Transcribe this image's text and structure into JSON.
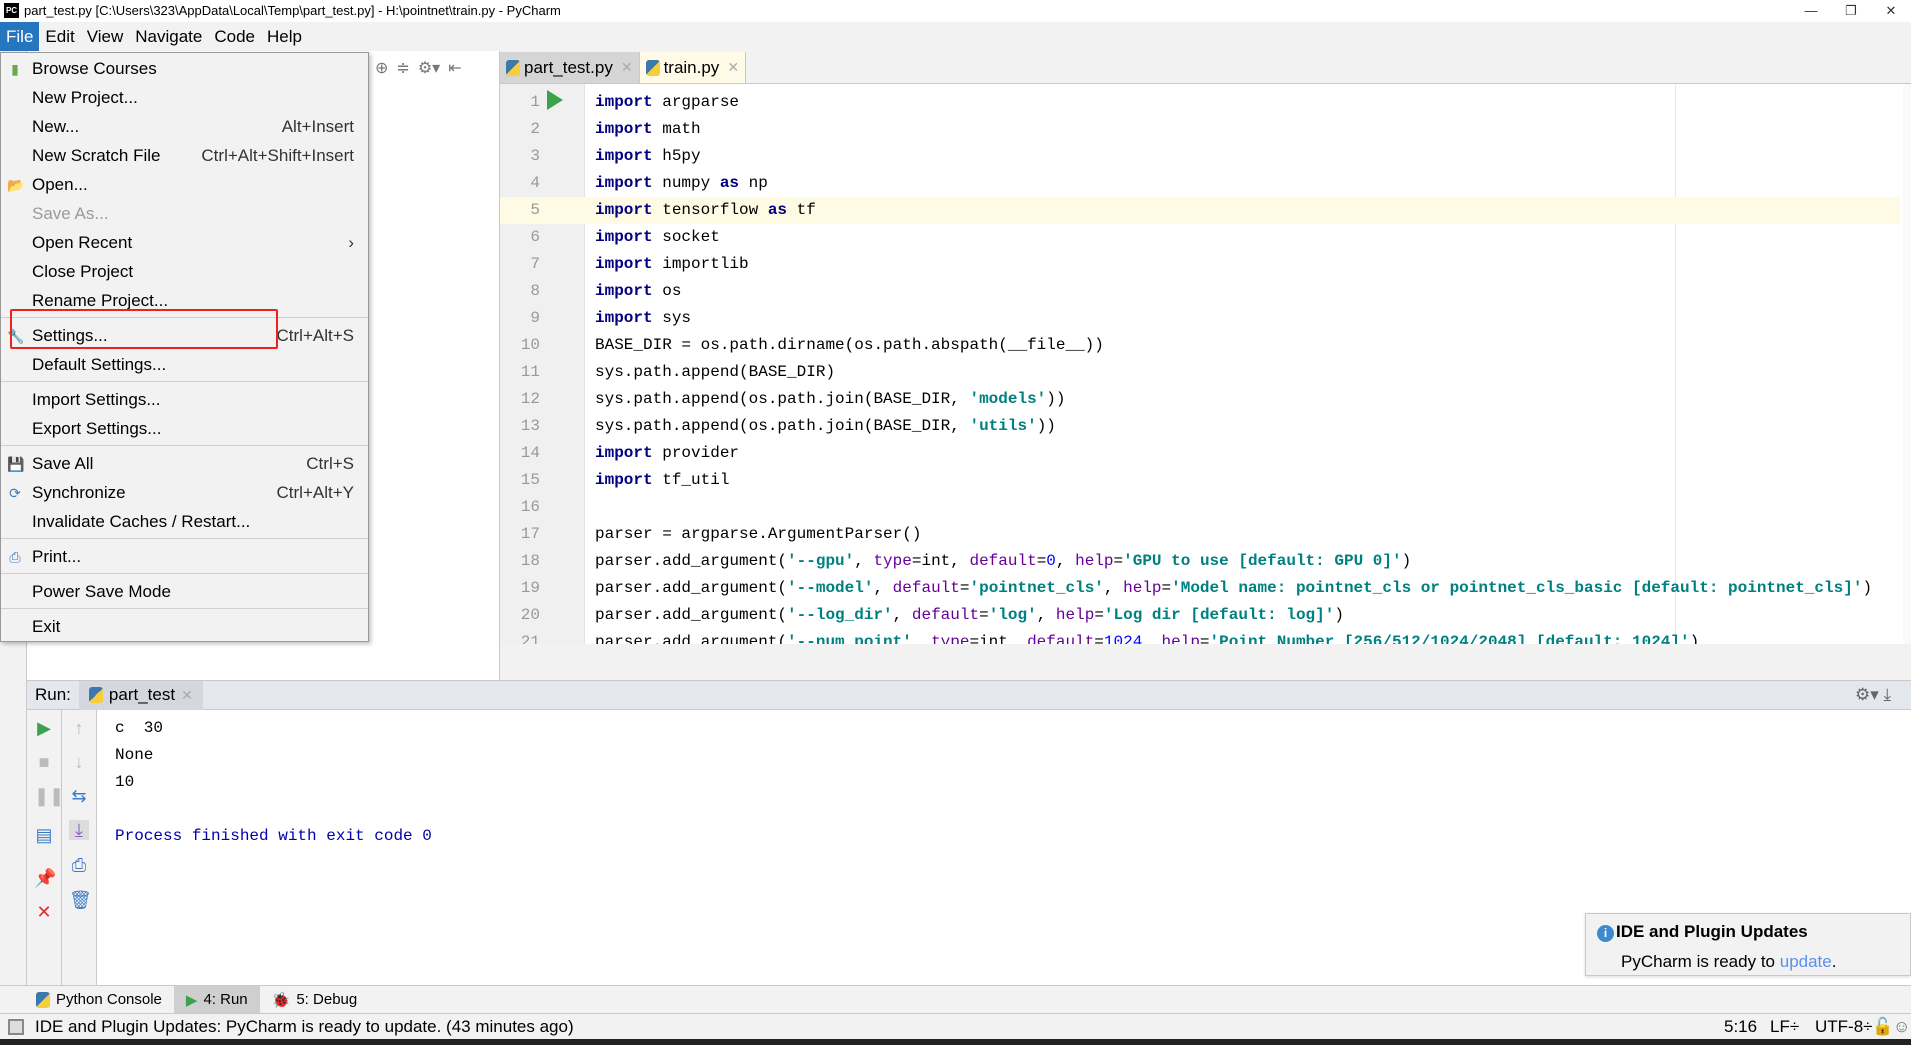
{
  "window": {
    "title": "part_test.py [C:\\Users\\323\\AppData\\Local\\Temp\\part_test.py] - H:\\pointnet\\train.py - PyCharm",
    "logo": "PC",
    "minimize": "—",
    "restore": "❐",
    "close": "✕"
  },
  "menubar": [
    "File",
    "Edit",
    "View",
    "Navigate",
    "Code",
    "Help"
  ],
  "file_menu": {
    "groups": [
      [
        {
          "label": "Browse Courses",
          "icon": "book-icon",
          "shortcut": ""
        },
        {
          "label": "New Project...",
          "shortcut": ""
        },
        {
          "label": "New...",
          "shortcut": "Alt+Insert"
        },
        {
          "label": "New Scratch File",
          "shortcut": "Ctrl+Alt+Shift+Insert"
        },
        {
          "label": "Open...",
          "icon": "folder-icon",
          "shortcut": ""
        },
        {
          "label": "Save As...",
          "shortcut": "",
          "disabled": true
        },
        {
          "label": "Open Recent",
          "shortcut": "",
          "submenu": true
        },
        {
          "label": "Close Project",
          "shortcut": ""
        },
        {
          "label": "Rename Project...",
          "shortcut": ""
        }
      ],
      [
        {
          "label": "Settings...",
          "icon": "wrench-icon",
          "shortcut": "Ctrl+Alt+S",
          "highlighted_box": true
        },
        {
          "label": "Default Settings...",
          "shortcut": ""
        }
      ],
      [
        {
          "label": "Import Settings...",
          "shortcut": ""
        },
        {
          "label": "Export Settings...",
          "shortcut": ""
        }
      ],
      [
        {
          "label": "Save All",
          "icon": "save-icon",
          "shortcut": "Ctrl+S"
        },
        {
          "label": "Synchronize",
          "icon": "sync-icon",
          "shortcut": "Ctrl+Alt+Y"
        },
        {
          "label": "Invalidate Caches / Restart...",
          "shortcut": ""
        }
      ],
      [
        {
          "label": "Print...",
          "icon": "printer-icon",
          "shortcut": ""
        }
      ],
      [
        {
          "label": "Power Save Mode",
          "shortcut": ""
        }
      ],
      [
        {
          "label": "Exit",
          "shortcut": ""
        }
      ]
    ],
    "highlight_color": "#f02020"
  },
  "editor": {
    "tabs": [
      {
        "label": "part_test.py",
        "active": false
      },
      {
        "label": "train.py",
        "active": true
      }
    ],
    "current_line": 5,
    "lines": [
      [
        [
          "import",
          "kw"
        ],
        [
          " argparse",
          ""
        ]
      ],
      [
        [
          "import",
          "kw"
        ],
        [
          " math",
          ""
        ]
      ],
      [
        [
          "import",
          "kw"
        ],
        [
          " h5py",
          ""
        ]
      ],
      [
        [
          "import",
          "kw"
        ],
        [
          " numpy ",
          ""
        ],
        [
          "as",
          "kw"
        ],
        [
          " np",
          ""
        ]
      ],
      [
        [
          "import",
          "kw"
        ],
        [
          " tensorflow ",
          ""
        ],
        [
          "as",
          "kw"
        ],
        [
          " tf",
          ""
        ]
      ],
      [
        [
          "import",
          "kw"
        ],
        [
          " socket",
          ""
        ]
      ],
      [
        [
          "import",
          "kw"
        ],
        [
          " importlib",
          ""
        ]
      ],
      [
        [
          "import",
          "kw"
        ],
        [
          " os",
          ""
        ]
      ],
      [
        [
          "import",
          "kw"
        ],
        [
          " sys",
          ""
        ]
      ],
      [
        [
          "BASE_DIR = os.path.dirname(os.path.abspath(__file__))",
          ""
        ]
      ],
      [
        [
          "sys.path.append(BASE_DIR)",
          ""
        ]
      ],
      [
        [
          "sys.path.append(os.path.join(BASE_DIR, ",
          ""
        ],
        [
          "'models'",
          "str"
        ],
        [
          "))",
          ""
        ]
      ],
      [
        [
          "sys.path.append(os.path.join(BASE_DIR, ",
          ""
        ],
        [
          "'utils'",
          "str"
        ],
        [
          "))",
          ""
        ]
      ],
      [
        [
          "import",
          "kw"
        ],
        [
          " provider",
          ""
        ]
      ],
      [
        [
          "import",
          "kw"
        ],
        [
          " tf_util",
          ""
        ]
      ],
      [],
      [
        [
          "parser = argparse.ArgumentParser()",
          ""
        ]
      ],
      [
        [
          "parser.add_argument(",
          ""
        ],
        [
          "'--gpu'",
          "str"
        ],
        [
          ", ",
          ""
        ],
        [
          "type",
          "kwarg"
        ],
        [
          "=int, ",
          ""
        ],
        [
          "default",
          "kwarg"
        ],
        [
          "=",
          ""
        ],
        [
          "0",
          "num"
        ],
        [
          ", ",
          ""
        ],
        [
          "help",
          "kwarg"
        ],
        [
          "=",
          ""
        ],
        [
          "'GPU to use [default: GPU 0]'",
          "str"
        ],
        [
          ")",
          ""
        ]
      ],
      [
        [
          "parser.add_argument(",
          ""
        ],
        [
          "'--model'",
          "str"
        ],
        [
          ", ",
          ""
        ],
        [
          "default",
          "kwarg"
        ],
        [
          "=",
          ""
        ],
        [
          "'pointnet_cls'",
          "str"
        ],
        [
          ", ",
          ""
        ],
        [
          "help",
          "kwarg"
        ],
        [
          "=",
          ""
        ],
        [
          "'Model name: pointnet_cls or pointnet_cls_basic [default: pointnet_cls]'",
          "str"
        ],
        [
          ")",
          ""
        ]
      ],
      [
        [
          "parser.add_argument(",
          ""
        ],
        [
          "'--log_dir'",
          "str"
        ],
        [
          ", ",
          ""
        ],
        [
          "default",
          "kwarg"
        ],
        [
          "=",
          ""
        ],
        [
          "'log'",
          "str"
        ],
        [
          ", ",
          ""
        ],
        [
          "help",
          "kwarg"
        ],
        [
          "=",
          ""
        ],
        [
          "'Log dir [default: log]'",
          "str"
        ],
        [
          ")",
          ""
        ]
      ],
      [
        [
          "parser.add_argument(",
          ""
        ],
        [
          "'--num_point'",
          "str"
        ],
        [
          ", ",
          ""
        ],
        [
          "type",
          "kwarg"
        ],
        [
          "=int, ",
          ""
        ],
        [
          "default",
          "kwarg"
        ],
        [
          "=",
          ""
        ],
        [
          "1024",
          "num"
        ],
        [
          ", ",
          ""
        ],
        [
          "help",
          "kwarg"
        ],
        [
          "=",
          ""
        ],
        [
          "'Point Number [256/512/1024/2048] [default: 1024]'",
          "str"
        ],
        [
          ")",
          ""
        ]
      ]
    ]
  },
  "run": {
    "label": "Run:",
    "tab": "part_test",
    "output": [
      {
        "text": "c  30",
        "type": "out"
      },
      {
        "text": "None",
        "type": "out"
      },
      {
        "text": "10",
        "type": "out"
      },
      {
        "text": "",
        "type": "out"
      },
      {
        "text": "Process finished with exit code 0",
        "type": "sys"
      }
    ]
  },
  "tool_windows": [
    {
      "label": "Python Console",
      "icon": "python-console-icon",
      "active": false
    },
    {
      "label": "4: Run",
      "icon": "run-icon",
      "active": true
    },
    {
      "label": "5: Debug",
      "icon": "bug-icon",
      "active": false
    }
  ],
  "notification": {
    "title": "IDE and Plugin Updates",
    "body_prefix": "PyCharm is ready to ",
    "link": "update",
    "body_suffix": "."
  },
  "status": {
    "message": "IDE and Plugin Updates: PyCharm is ready to update. (43 minutes ago)",
    "position": "5:16",
    "line_sep": "LF÷",
    "encoding": "UTF-8÷"
  }
}
